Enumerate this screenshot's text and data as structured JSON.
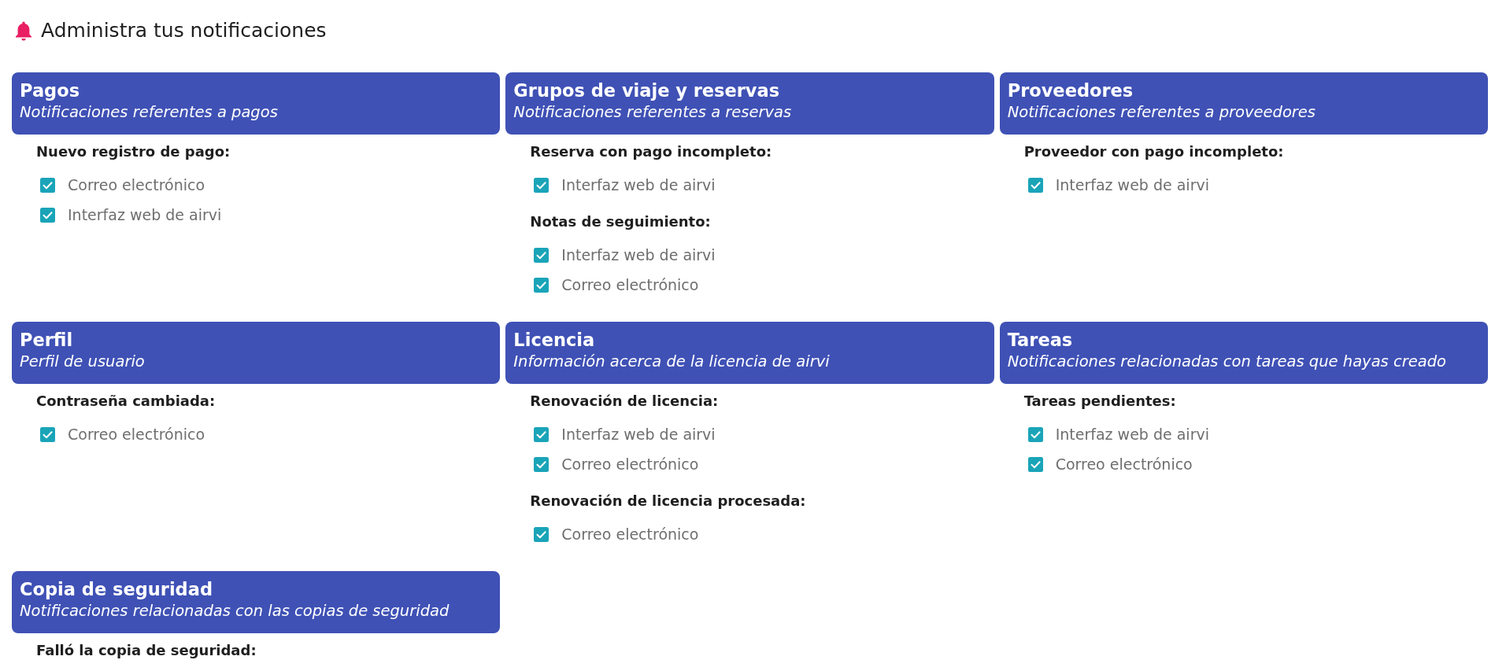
{
  "page": {
    "title": "Administra tus notificaciones"
  },
  "categories": [
    {
      "title": "Pagos",
      "subtitle": "Notificaciones referentes a pagos",
      "sections": [
        {
          "label": "Nuevo registro de pago:",
          "options": [
            {
              "label": "Correo electrónico",
              "checked": true
            },
            {
              "label": "Interfaz web de airvi",
              "checked": true
            }
          ]
        }
      ]
    },
    {
      "title": "Grupos de viaje y reservas",
      "subtitle": "Notificaciones referentes a reservas",
      "sections": [
        {
          "label": "Reserva con pago incompleto:",
          "options": [
            {
              "label": "Interfaz web de airvi",
              "checked": true
            }
          ]
        },
        {
          "label": "Notas de seguimiento:",
          "options": [
            {
              "label": "Interfaz web de airvi",
              "checked": true
            },
            {
              "label": "Correo electrónico",
              "checked": true
            }
          ]
        }
      ]
    },
    {
      "title": "Proveedores",
      "subtitle": "Notificaciones referentes a proveedores",
      "sections": [
        {
          "label": "Proveedor con pago incompleto:",
          "options": [
            {
              "label": "Interfaz web de airvi",
              "checked": true
            }
          ]
        }
      ]
    },
    {
      "title": "Perfil",
      "subtitle": "Perfil de usuario",
      "sections": [
        {
          "label": "Contraseña cambiada:",
          "options": [
            {
              "label": "Correo electrónico",
              "checked": true
            }
          ]
        }
      ]
    },
    {
      "title": "Licencia",
      "subtitle": "Información acerca de la licencia de airvi",
      "sections": [
        {
          "label": "Renovación de licencia:",
          "options": [
            {
              "label": "Interfaz web de airvi",
              "checked": true
            },
            {
              "label": "Correo electrónico",
              "checked": true
            }
          ]
        },
        {
          "label": "Renovación de licencia procesada:",
          "options": [
            {
              "label": "Correo electrónico",
              "checked": true
            }
          ]
        }
      ]
    },
    {
      "title": "Tareas",
      "subtitle": "Notificaciones relacionadas con tareas que hayas creado",
      "sections": [
        {
          "label": "Tareas pendientes:",
          "options": [
            {
              "label": "Interfaz web de airvi",
              "checked": true
            },
            {
              "label": "Correo electrónico",
              "checked": true
            }
          ]
        }
      ]
    },
    {
      "title": "Copia de seguridad",
      "subtitle": "Notificaciones relacionadas con las copias de seguridad",
      "sections": [
        {
          "label": "Falló la copia de seguridad:"
        }
      ]
    }
  ]
}
